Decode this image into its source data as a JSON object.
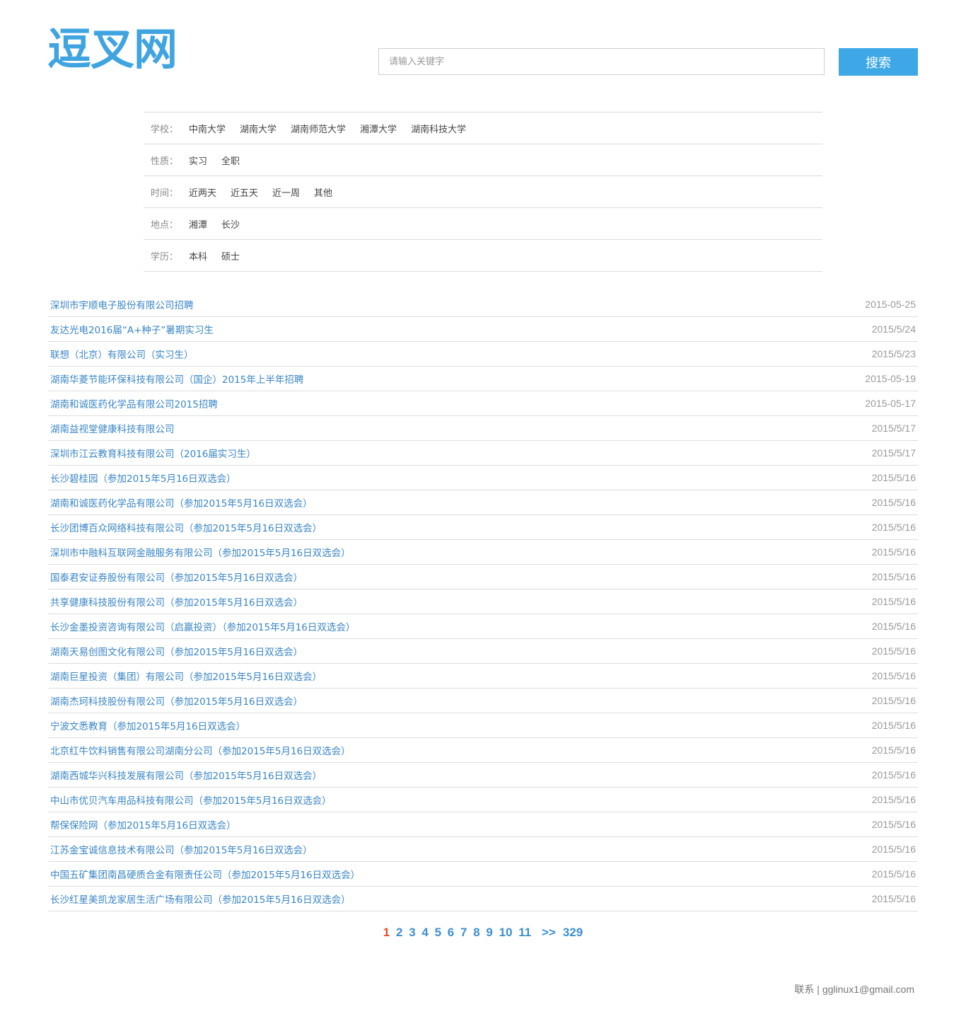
{
  "header": {
    "logo": "逗叉网",
    "search": {
      "placeholder": "请输入关键字",
      "value": ""
    },
    "search_button": "搜索"
  },
  "filters": [
    {
      "label": "学校：",
      "options": [
        "中南大学",
        "湖南大学",
        "湖南师范大学",
        "湘潭大学",
        "湖南科技大学"
      ]
    },
    {
      "label": "性质：",
      "options": [
        "实习",
        "全职"
      ]
    },
    {
      "label": "时间：",
      "options": [
        "近两天",
        "近五天",
        "近一周",
        "其他"
      ]
    },
    {
      "label": "地点：",
      "options": [
        "湘潭",
        "长沙"
      ]
    },
    {
      "label": "学历：",
      "options": [
        "本科",
        "硕士"
      ]
    }
  ],
  "jobs": [
    {
      "title": "深圳市宇顺电子股份有限公司招聘",
      "date": "2015-05-25"
    },
    {
      "title": "友达光电2016届“A+种子”暑期实习生",
      "date": "2015/5/24"
    },
    {
      "title": "联想（北京）有限公司（实习生）",
      "date": "2015/5/23"
    },
    {
      "title": "湖南华菱节能环保科技有限公司（国企）2015年上半年招聘",
      "date": "2015-05-19"
    },
    {
      "title": "湖南和诚医药化学品有限公司2015招聘",
      "date": "2015-05-17"
    },
    {
      "title": "湖南益视堂健康科技有限公司",
      "date": "2015/5/17"
    },
    {
      "title": "深圳市江云教育科技有限公司（2016届实习生）",
      "date": "2015/5/17"
    },
    {
      "title": "长沙碧桂园（参加2015年5月16日双选会）",
      "date": "2015/5/16"
    },
    {
      "title": "湖南和诚医药化学品有限公司（参加2015年5月16日双选会）",
      "date": "2015/5/16"
    },
    {
      "title": "长沙团博百众网络科技有限公司（参加2015年5月16日双选会）",
      "date": "2015/5/16"
    },
    {
      "title": "深圳市中融科互联网金融服务有限公司（参加2015年5月16日双选会）",
      "date": "2015/5/16"
    },
    {
      "title": "国泰君安证券股份有限公司（参加2015年5月16日双选会）",
      "date": "2015/5/16"
    },
    {
      "title": "共享健康科技股份有限公司（参加2015年5月16日双选会）",
      "date": "2015/5/16"
    },
    {
      "title": "长沙金墨投资咨询有限公司（启赢投资）（参加2015年5月16日双选会）",
      "date": "2015/5/16"
    },
    {
      "title": "湖南天易创图文化有限公司（参加2015年5月16日双选会）",
      "date": "2015/5/16"
    },
    {
      "title": "湖南巨星投资（集团）有限公司（参加2015年5月16日双选会）",
      "date": "2015/5/16"
    },
    {
      "title": "湖南杰珂科技股份有限公司（参加2015年5月16日双选会）",
      "date": "2015/5/16"
    },
    {
      "title": "宁波文悉教育（参加2015年5月16日双选会）",
      "date": "2015/5/16"
    },
    {
      "title": "北京红牛饮料销售有限公司湖南分公司（参加2015年5月16日双选会）",
      "date": "2015/5/16"
    },
    {
      "title": "湖南西城华兴科技发展有限公司（参加2015年5月16日双选会）",
      "date": "2015/5/16"
    },
    {
      "title": "中山市优贝汽车用品科技有限公司（参加2015年5月16日双选会）",
      "date": "2015/5/16"
    },
    {
      "title": "帮保保险网（参加2015年5月16日双选会）",
      "date": "2015/5/16"
    },
    {
      "title": "江苏金宝诚信息技术有限公司（参加2015年5月16日双选会）",
      "date": "2015/5/16"
    },
    {
      "title": "中国五矿集团南昌硬质合金有限责任公司（参加2015年5月16日双选会）",
      "date": "2015/5/16"
    },
    {
      "title": "长沙红星美凯龙家居生活广场有限公司（参加2015年5月16日双选会）",
      "date": "2015/5/16"
    }
  ],
  "pagination": {
    "current": "1",
    "pages": [
      "2",
      "3",
      "4",
      "5",
      "6",
      "7",
      "8",
      "9",
      "10",
      "11"
    ],
    "next": ">>",
    "last": "329"
  },
  "footer": {
    "contact": "联系 | gglinux1@gmail.com"
  },
  "colors": {
    "accent": "#3ea8e6",
    "link": "#3b86c6",
    "current_page": "#e24a2c"
  }
}
